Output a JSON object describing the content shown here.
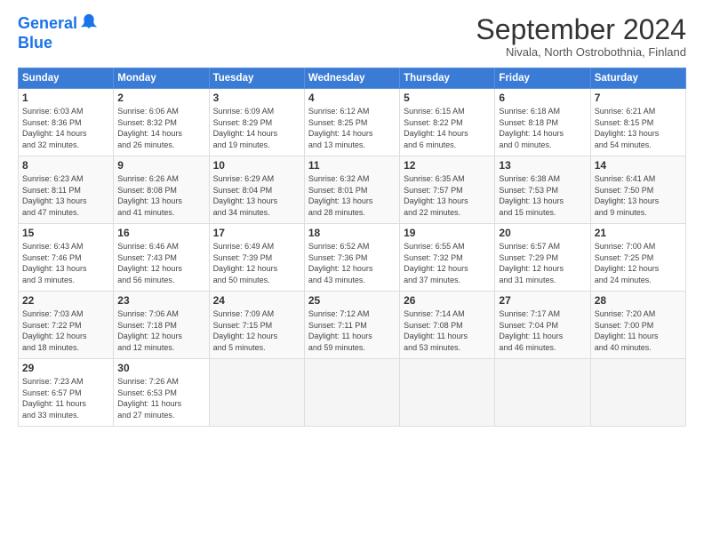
{
  "logo": {
    "line1": "General",
    "line2": "Blue"
  },
  "title": "September 2024",
  "subtitle": "Nivala, North Ostrobothnia, Finland",
  "days_header": [
    "Sunday",
    "Monday",
    "Tuesday",
    "Wednesday",
    "Thursday",
    "Friday",
    "Saturday"
  ],
  "weeks": [
    [
      {
        "num": "1",
        "info": "Sunrise: 6:03 AM\nSunset: 8:36 PM\nDaylight: 14 hours\nand 32 minutes."
      },
      {
        "num": "2",
        "info": "Sunrise: 6:06 AM\nSunset: 8:32 PM\nDaylight: 14 hours\nand 26 minutes."
      },
      {
        "num": "3",
        "info": "Sunrise: 6:09 AM\nSunset: 8:29 PM\nDaylight: 14 hours\nand 19 minutes."
      },
      {
        "num": "4",
        "info": "Sunrise: 6:12 AM\nSunset: 8:25 PM\nDaylight: 14 hours\nand 13 minutes."
      },
      {
        "num": "5",
        "info": "Sunrise: 6:15 AM\nSunset: 8:22 PM\nDaylight: 14 hours\nand 6 minutes."
      },
      {
        "num": "6",
        "info": "Sunrise: 6:18 AM\nSunset: 8:18 PM\nDaylight: 14 hours\nand 0 minutes."
      },
      {
        "num": "7",
        "info": "Sunrise: 6:21 AM\nSunset: 8:15 PM\nDaylight: 13 hours\nand 54 minutes."
      }
    ],
    [
      {
        "num": "8",
        "info": "Sunrise: 6:23 AM\nSunset: 8:11 PM\nDaylight: 13 hours\nand 47 minutes."
      },
      {
        "num": "9",
        "info": "Sunrise: 6:26 AM\nSunset: 8:08 PM\nDaylight: 13 hours\nand 41 minutes."
      },
      {
        "num": "10",
        "info": "Sunrise: 6:29 AM\nSunset: 8:04 PM\nDaylight: 13 hours\nand 34 minutes."
      },
      {
        "num": "11",
        "info": "Sunrise: 6:32 AM\nSunset: 8:01 PM\nDaylight: 13 hours\nand 28 minutes."
      },
      {
        "num": "12",
        "info": "Sunrise: 6:35 AM\nSunset: 7:57 PM\nDaylight: 13 hours\nand 22 minutes."
      },
      {
        "num": "13",
        "info": "Sunrise: 6:38 AM\nSunset: 7:53 PM\nDaylight: 13 hours\nand 15 minutes."
      },
      {
        "num": "14",
        "info": "Sunrise: 6:41 AM\nSunset: 7:50 PM\nDaylight: 13 hours\nand 9 minutes."
      }
    ],
    [
      {
        "num": "15",
        "info": "Sunrise: 6:43 AM\nSunset: 7:46 PM\nDaylight: 13 hours\nand 3 minutes."
      },
      {
        "num": "16",
        "info": "Sunrise: 6:46 AM\nSunset: 7:43 PM\nDaylight: 12 hours\nand 56 minutes."
      },
      {
        "num": "17",
        "info": "Sunrise: 6:49 AM\nSunset: 7:39 PM\nDaylight: 12 hours\nand 50 minutes."
      },
      {
        "num": "18",
        "info": "Sunrise: 6:52 AM\nSunset: 7:36 PM\nDaylight: 12 hours\nand 43 minutes."
      },
      {
        "num": "19",
        "info": "Sunrise: 6:55 AM\nSunset: 7:32 PM\nDaylight: 12 hours\nand 37 minutes."
      },
      {
        "num": "20",
        "info": "Sunrise: 6:57 AM\nSunset: 7:29 PM\nDaylight: 12 hours\nand 31 minutes."
      },
      {
        "num": "21",
        "info": "Sunrise: 7:00 AM\nSunset: 7:25 PM\nDaylight: 12 hours\nand 24 minutes."
      }
    ],
    [
      {
        "num": "22",
        "info": "Sunrise: 7:03 AM\nSunset: 7:22 PM\nDaylight: 12 hours\nand 18 minutes."
      },
      {
        "num": "23",
        "info": "Sunrise: 7:06 AM\nSunset: 7:18 PM\nDaylight: 12 hours\nand 12 minutes."
      },
      {
        "num": "24",
        "info": "Sunrise: 7:09 AM\nSunset: 7:15 PM\nDaylight: 12 hours\nand 5 minutes."
      },
      {
        "num": "25",
        "info": "Sunrise: 7:12 AM\nSunset: 7:11 PM\nDaylight: 11 hours\nand 59 minutes."
      },
      {
        "num": "26",
        "info": "Sunrise: 7:14 AM\nSunset: 7:08 PM\nDaylight: 11 hours\nand 53 minutes."
      },
      {
        "num": "27",
        "info": "Sunrise: 7:17 AM\nSunset: 7:04 PM\nDaylight: 11 hours\nand 46 minutes."
      },
      {
        "num": "28",
        "info": "Sunrise: 7:20 AM\nSunset: 7:00 PM\nDaylight: 11 hours\nand 40 minutes."
      }
    ],
    [
      {
        "num": "29",
        "info": "Sunrise: 7:23 AM\nSunset: 6:57 PM\nDaylight: 11 hours\nand 33 minutes."
      },
      {
        "num": "30",
        "info": "Sunrise: 7:26 AM\nSunset: 6:53 PM\nDaylight: 11 hours\nand 27 minutes."
      },
      {
        "num": "",
        "info": ""
      },
      {
        "num": "",
        "info": ""
      },
      {
        "num": "",
        "info": ""
      },
      {
        "num": "",
        "info": ""
      },
      {
        "num": "",
        "info": ""
      }
    ]
  ]
}
